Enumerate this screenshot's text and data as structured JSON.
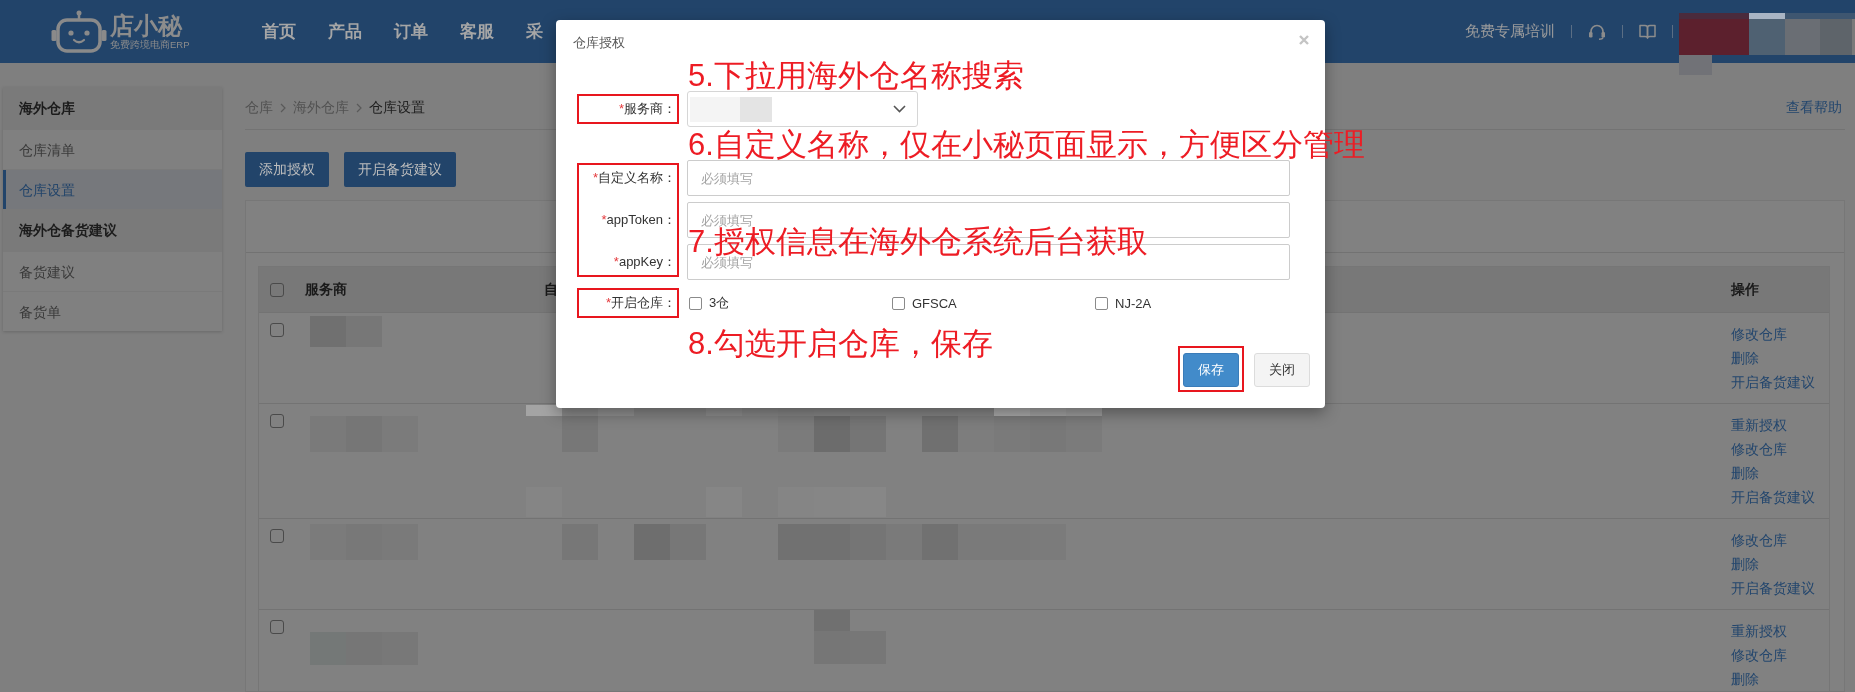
{
  "top_bar": {
    "logo": {
      "name": "店小秘",
      "tagline": "免费跨境电商ERP"
    },
    "nav": [
      {
        "label": "首页",
        "selected": false
      },
      {
        "label": "产品",
        "selected": false
      },
      {
        "label": "订单",
        "selected": false
      },
      {
        "label": "客服",
        "selected": false
      },
      {
        "label": "采",
        "selected": false
      }
    ],
    "training_link": "免费专属培训"
  },
  "sidebar": {
    "sections": [
      {
        "title": "海外仓库",
        "items": [
          {
            "label": "仓库清单",
            "selected": false
          },
          {
            "label": "仓库设置",
            "selected": true
          }
        ]
      },
      {
        "title": "海外仓备货建议",
        "items": [
          {
            "label": "备货建议",
            "selected": false
          },
          {
            "label": "备货单",
            "selected": false
          }
        ]
      }
    ]
  },
  "breadcrumb": [
    "仓库",
    "海外仓库",
    "仓库设置"
  ],
  "help_link": "查看帮助",
  "toolbar": {
    "buttons": [
      "添加授权",
      "开启备货建议"
    ]
  },
  "table": {
    "header_checked": false,
    "columns": [
      "服务商",
      "自",
      "操作"
    ],
    "rows": [
      {
        "checked": false,
        "actions": [
          "修改仓库",
          "删除",
          "开启备货建议"
        ]
      },
      {
        "checked": false,
        "actions": [
          "重新授权",
          "修改仓库",
          "删除",
          "开启备货建议"
        ]
      },
      {
        "checked": false,
        "actions": [
          "修改仓库",
          "删除",
          "开启备货建议"
        ]
      },
      {
        "checked": false,
        "actions": [
          "重新授权",
          "修改仓库",
          "删除"
        ]
      }
    ]
  },
  "dialog": {
    "title": "仓库授权",
    "groups": [
      {
        "highlighted": true,
        "note": "5.下拉用海外仓名称搜索",
        "fields": [
          {
            "kind": "select",
            "required_mark": "*",
            "label": "服务商："
          }
        ]
      },
      {
        "highlighted": true,
        "note": "6.自定义名称，仅在小秘页面显示，方便区分管理",
        "fields": [
          {
            "kind": "text",
            "required_mark": "*",
            "label": "自定义名称：",
            "placeholder": "必须填写"
          },
          {
            "kind": "text",
            "required_mark": "*",
            "label": "appToken：",
            "placeholder": "必须填写",
            "note": "7.授权信息在海外仓系统后台获取"
          },
          {
            "kind": "text",
            "required_mark": "*",
            "label": "appKey：",
            "placeholder": "必须填写"
          }
        ]
      },
      {
        "highlighted": true,
        "fields": [
          {
            "kind": "checkboxes",
            "required_mark": "*",
            "label": "开启仓库：",
            "options": [
              {
                "label": "3仓",
                "checked": false
              },
              {
                "label": "GFSCA",
                "checked": false
              },
              {
                "label": "NJ-2A",
                "checked": false
              }
            ]
          }
        ]
      }
    ],
    "footer_note": "8.勾选开启仓库，保存",
    "buttons": [
      {
        "label": "保存",
        "kind": "primary",
        "highlighted": true
      },
      {
        "label": "关闭",
        "kind": "default",
        "highlighted": false
      }
    ]
  }
}
